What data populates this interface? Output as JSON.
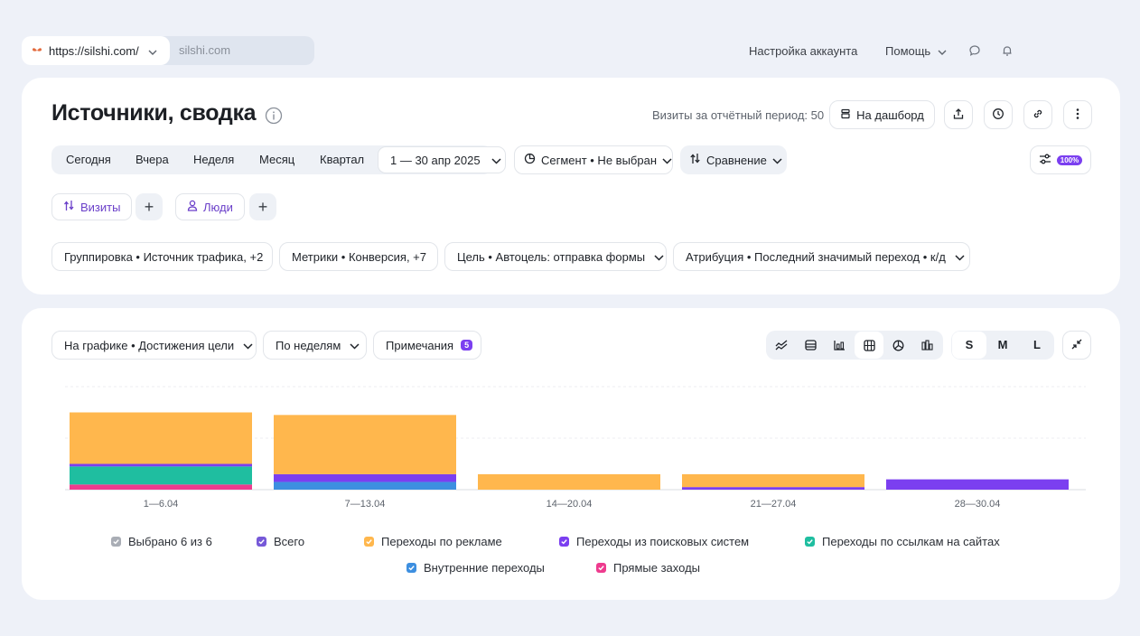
{
  "topbar": {
    "url": "https://silshi.com/",
    "site": "silshi.com",
    "account_settings": "Настройка аккаунта",
    "help": "Помощь"
  },
  "header": {
    "title": "Источники, сводка",
    "visits_label": "Визиты за отчётный период: 50",
    "dashboard_button": "На дашборд"
  },
  "period": {
    "items": [
      "Сегодня",
      "Вчера",
      "Неделя",
      "Месяц",
      "Квартал"
    ],
    "date_range": "1 — 30 апр 2025"
  },
  "segment_label": "Сегмент • Не выбран",
  "comparison_label": "Сравнение",
  "sampling_badge": "100%",
  "tabs": {
    "visits": "Визиты",
    "people": "Люди"
  },
  "filters": [
    "Группировка • Источник трафика, +2",
    "Метрики • Конверсия, +7",
    "Цель • Автоцель: отправка формы",
    "Атрибуция • Последний значимый переход • к/д"
  ],
  "chart_toolbar": {
    "graph_selector": "На графике • Достижения цели",
    "interval_selector": "По неделям",
    "notes_label": "Примечания",
    "notes_count": "5",
    "sizes": [
      "S",
      "M",
      "L"
    ],
    "active_size": "S"
  },
  "colors": {
    "ads": "#ffb74d",
    "search": "#7b3ff0",
    "links": "#1fbea0",
    "internal": "#3d8fe0",
    "direct": "#ee3b8e",
    "total": "#7659d8",
    "selected": "#a9adb5"
  },
  "chart_data": {
    "type": "bar",
    "stacked": true,
    "categories": [
      "1—6.04",
      "7—13.04",
      "14—20.04",
      "21—27.04",
      "28—30.04"
    ],
    "ylim": [
      0,
      20
    ],
    "grid": true,
    "series": [
      {
        "name": "Прямые заходы",
        "color": "#ee3b8e",
        "values": [
          1,
          0,
          0,
          0,
          0
        ]
      },
      {
        "name": "Переходы по ссылкам на сайтах",
        "color": "#1fbea0",
        "values": [
          3.5,
          0,
          0,
          0,
          0
        ]
      },
      {
        "name": "Внутренние переходы",
        "color": "#3d8fe0",
        "values": [
          0,
          1.5,
          0,
          0,
          0
        ]
      },
      {
        "name": "Переходы из поисковых систем",
        "color": "#7b3ff0",
        "values": [
          0.5,
          1.5,
          0,
          0.5,
          2
        ]
      },
      {
        "name": "Переходы по рекламе",
        "color": "#ffb74d",
        "values": [
          10,
          11.5,
          3,
          2.5,
          0
        ]
      }
    ]
  },
  "legend": [
    {
      "label": "Выбрано 6 из 6",
      "color": "#a9adb5"
    },
    {
      "label": "Всего",
      "color": "#7659d8"
    },
    {
      "label": "Переходы по рекламе",
      "color": "#ffb74d"
    },
    {
      "label": "Переходы из поисковых систем",
      "color": "#7b3ff0"
    },
    {
      "label": "Переходы по ссылкам на сайтах",
      "color": "#1fbea0"
    },
    {
      "label": "Внутренние переходы",
      "color": "#3d8fe0"
    },
    {
      "label": "Прямые заходы",
      "color": "#ee3b8e"
    }
  ]
}
